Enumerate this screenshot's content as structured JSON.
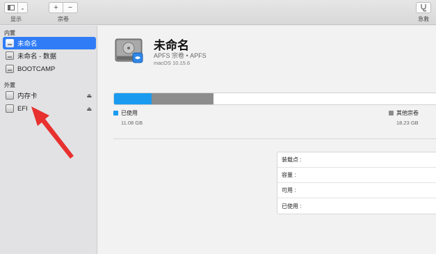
{
  "toolbar": {
    "view_label": "显示",
    "volume_label": "宗卷",
    "add_glyph": "+",
    "remove_glyph": "−",
    "firstaid_label": "急救",
    "view_chevron": "⌄"
  },
  "sidebar": {
    "internal_header": "内置",
    "external_header": "外置",
    "items": [
      {
        "label": "未命名",
        "selected": true
      },
      {
        "label": "未命名 - 数据"
      },
      {
        "label": "BOOTCAMP"
      }
    ],
    "external_items": [
      {
        "label": "内存卡",
        "eject": "⏏"
      },
      {
        "label": "EFI",
        "eject": "⏏"
      }
    ]
  },
  "volume": {
    "name": "未命名",
    "subtitle": "APFS 宗卷 • APFS",
    "os": "macOS 10.15.6"
  },
  "usage": {
    "used_label": "已使用",
    "used_value": "11.08 GB",
    "other_label": "其他宗卷",
    "other_value": "18.23 GB",
    "used_color": "#1a9bf0",
    "other_color": "#8c8c8c",
    "used_fraction": 0.115,
    "other_fraction": 0.19
  },
  "info": {
    "rows": [
      "装载点 :",
      "容量 :",
      "可用 :",
      "已使用 :"
    ]
  },
  "colors": {
    "selection": "#2f7cf6",
    "arrow": "#e8312f"
  }
}
